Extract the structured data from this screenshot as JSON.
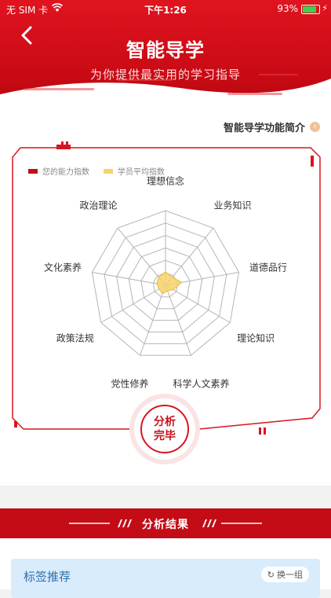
{
  "status_bar": {
    "carrier": "无 SIM 卡",
    "time": "下午1:26",
    "battery_pct": "93%",
    "battery_level": 0.93
  },
  "header": {
    "title": "智能导学",
    "subtitle": "为你提供最实用的学习指导"
  },
  "intro_link": "智能导学功能简介",
  "legend": [
    {
      "label": "您的能力指数",
      "color": "#c0101a"
    },
    {
      "label": "学员平均指数",
      "color": "#f6d36b"
    }
  ],
  "radar": {
    "dimensions": [
      "理想信念",
      "业务知识",
      "道德品行",
      "理论知识",
      "科学人文素养",
      "党性修养",
      "政策法规",
      "文化素养",
      "政治理论"
    ],
    "rings": 6,
    "your_index": [
      0,
      0,
      0,
      0,
      0,
      0,
      0,
      0,
      0
    ],
    "average_index": [
      0.18,
      0.14,
      0.22,
      0.12,
      0.08,
      0.12,
      0.1,
      0.12,
      0.14
    ]
  },
  "done_button": {
    "line1": "分析",
    "line2": "完毕"
  },
  "result": {
    "title": "分析结果"
  },
  "tag_recommend": {
    "title": "标签推荐",
    "swap_label": "换一组"
  },
  "colors": {
    "brand_red": "#d7151f",
    "average_fill": "#f6d36b"
  }
}
